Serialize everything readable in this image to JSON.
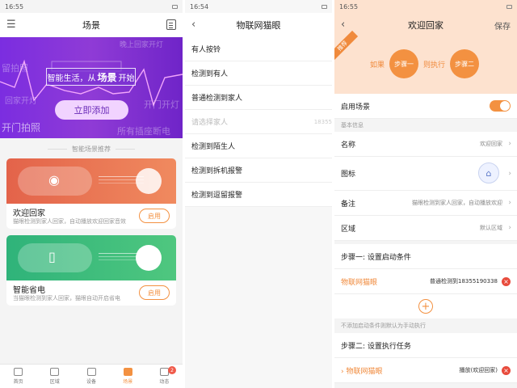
{
  "p1": {
    "status_time": "16:55",
    "title": "场景",
    "hero": {
      "slogan_pre": "智能生活，从",
      "slogan_strong": "场景",
      "slogan_post": "开始",
      "cta": "立即添加",
      "bg_words": [
        "留拍照",
        "晚上回家开灯",
        "回家开灯",
        "开门开灯",
        "开门拍照",
        "所有插座断电"
      ]
    },
    "recommend_title": "智能场景推荐",
    "cards": [
      {
        "name": "欢迎回家",
        "desc": "猫眼检测到家人回家，自动播放欢迎回家音效",
        "btn": "启用"
      },
      {
        "name": "智能省电",
        "desc": "当猫眼检测到家人回家，猫眼自动开启省电",
        "btn": "启用"
      }
    ],
    "tabs": [
      {
        "label": "首页"
      },
      {
        "label": "区域"
      },
      {
        "label": "设备"
      },
      {
        "label": "场景"
      },
      {
        "label": "动态",
        "badge": "2"
      }
    ]
  },
  "p2": {
    "status_time": "16:54",
    "title": "物联网猫眼",
    "items": [
      "有人按铃",
      "检测到有人",
      "普通检测到家人",
      "请选择家人",
      "检测到陌生人",
      "检测到拆机报警",
      "检测到逗留报警"
    ],
    "hint_right": "18355"
  },
  "p3": {
    "status_time": "16:55",
    "title": "欢迎回家",
    "save": "保存",
    "banner": {
      "tag": "推荐",
      "if": "如果",
      "step1": "步骤一",
      "then": "则执行",
      "step2": "步骤二"
    },
    "enable_label": "启用场景",
    "basic_info": "基本信息",
    "rows": {
      "name_label": "名称",
      "name_value": "欢迎回家",
      "icon_label": "图标",
      "note_label": "备注",
      "note_value": "猫眼检测到家人回家，自动播放欢迎",
      "area_label": "区域",
      "area_value": "默认区域"
    },
    "step1_title": "步骤一: 设置启动条件",
    "cond_device": "物联网猫眼",
    "cond_value": "普通检测到18355190338",
    "no_cond_note": "不添加启动条件则默认为手动执行",
    "step2_title": "步骤二: 设置执行任务",
    "task_device": "物联网猫眼",
    "task_value": "播放(欢迎回家)"
  },
  "colors": {
    "accent": "#f39141",
    "hero_purple": "#7b2de0",
    "card_orange": "#e3634a",
    "card_green": "#2fb37a"
  }
}
